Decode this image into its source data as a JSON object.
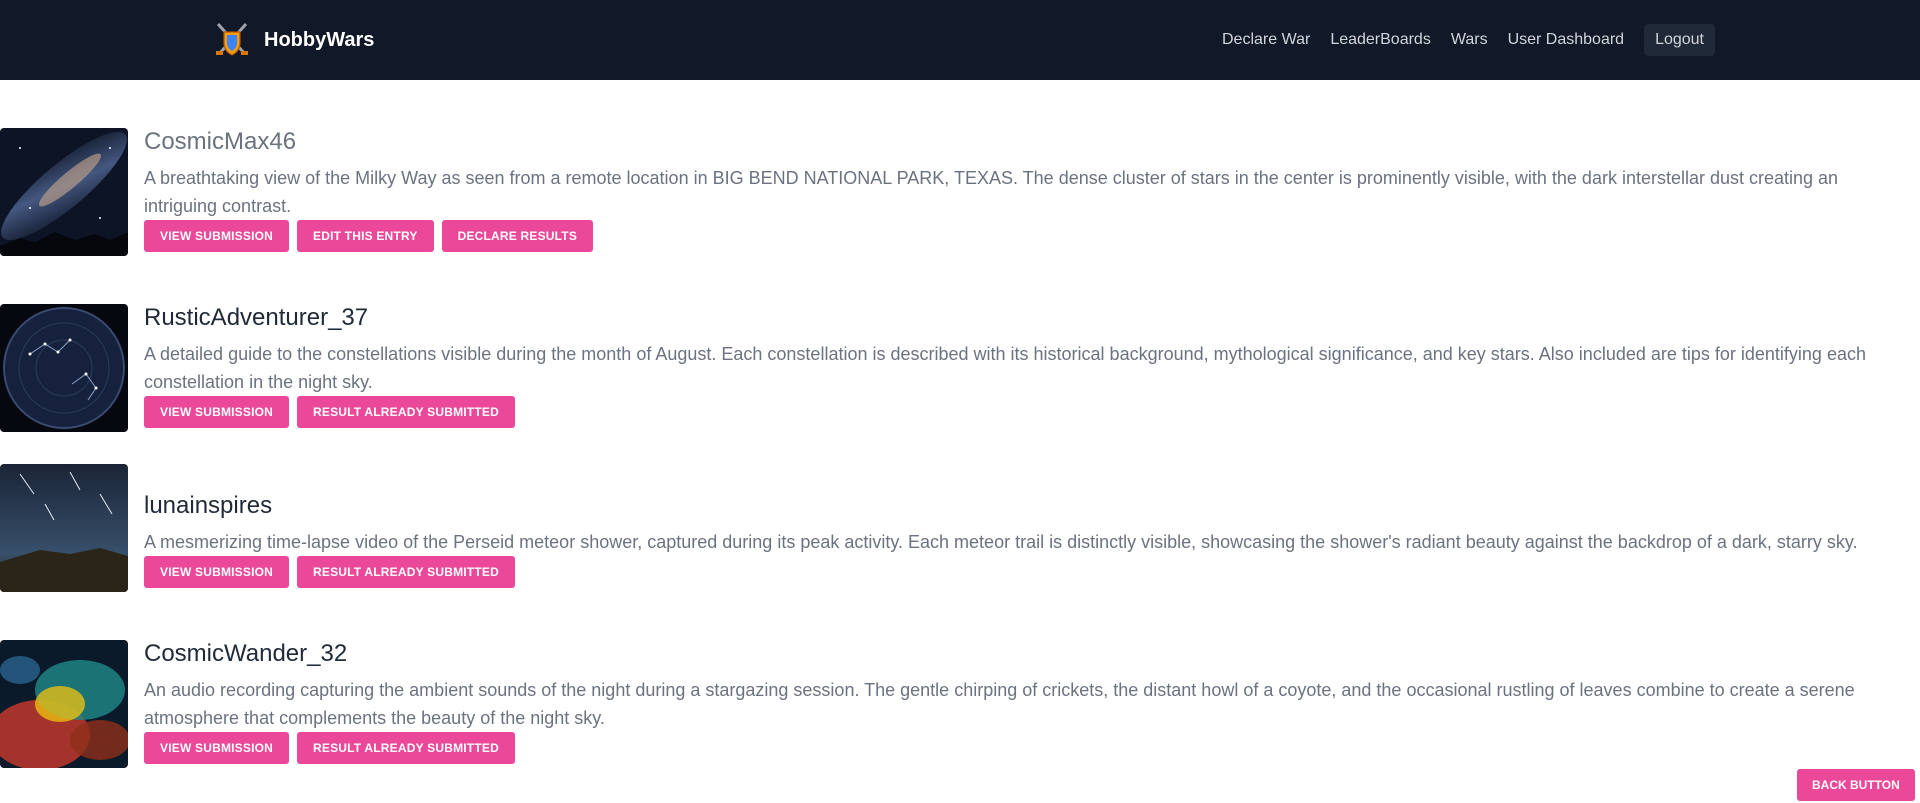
{
  "app": {
    "name": "HobbyWars"
  },
  "nav": {
    "links": [
      "Declare War",
      "LeaderBoards",
      "Wars",
      "User Dashboard"
    ],
    "logout": "Logout"
  },
  "entries": [
    {
      "user": "CosmicMax46",
      "description": "A breathtaking view of the Milky Way as seen from a remote location in BIG BEND NATIONAL PARK, TEXAS. The dense cluster of stars in the center is prominently visible, with the dark interstellar dust creating an intriguing contrast.",
      "buttons": [
        "VIEW SUBMISSION",
        "EDIT THIS ENTRY",
        "DECLARE RESULTS"
      ]
    },
    {
      "user": "RusticAdventurer_37",
      "description": "A detailed guide to the constellations visible during the month of August. Each constellation is described with its historical background, mythological significance, and key stars. Also included are tips for identifying each constellation in the night sky.",
      "buttons": [
        "VIEW SUBMISSION",
        "RESULT ALREADY SUBMITTED"
      ]
    },
    {
      "user": "lunainspires",
      "description": "A mesmerizing time-lapse video of the Perseid meteor shower, captured during its peak activity. Each meteor trail is distinctly visible, showcasing the shower's radiant beauty against the backdrop of a dark, starry sky.",
      "buttons": [
        "VIEW SUBMISSION",
        "RESULT ALREADY SUBMITTED"
      ]
    },
    {
      "user": "CosmicWander_32",
      "description": "An audio recording capturing the ambient sounds of the night during a stargazing session. The gentle chirping of crickets, the distant howl of a coyote, and the occasional rustling of leaves combine to create a serene atmosphere that complements the beauty of the night sky.",
      "buttons": [
        "VIEW SUBMISSION",
        "RESULT ALREADY SUBMITTED"
      ]
    }
  ],
  "back_button": "BACK BUTTON",
  "colors": {
    "navbar": "#111827",
    "accent": "#ec4899",
    "text_muted": "#6b7280"
  }
}
